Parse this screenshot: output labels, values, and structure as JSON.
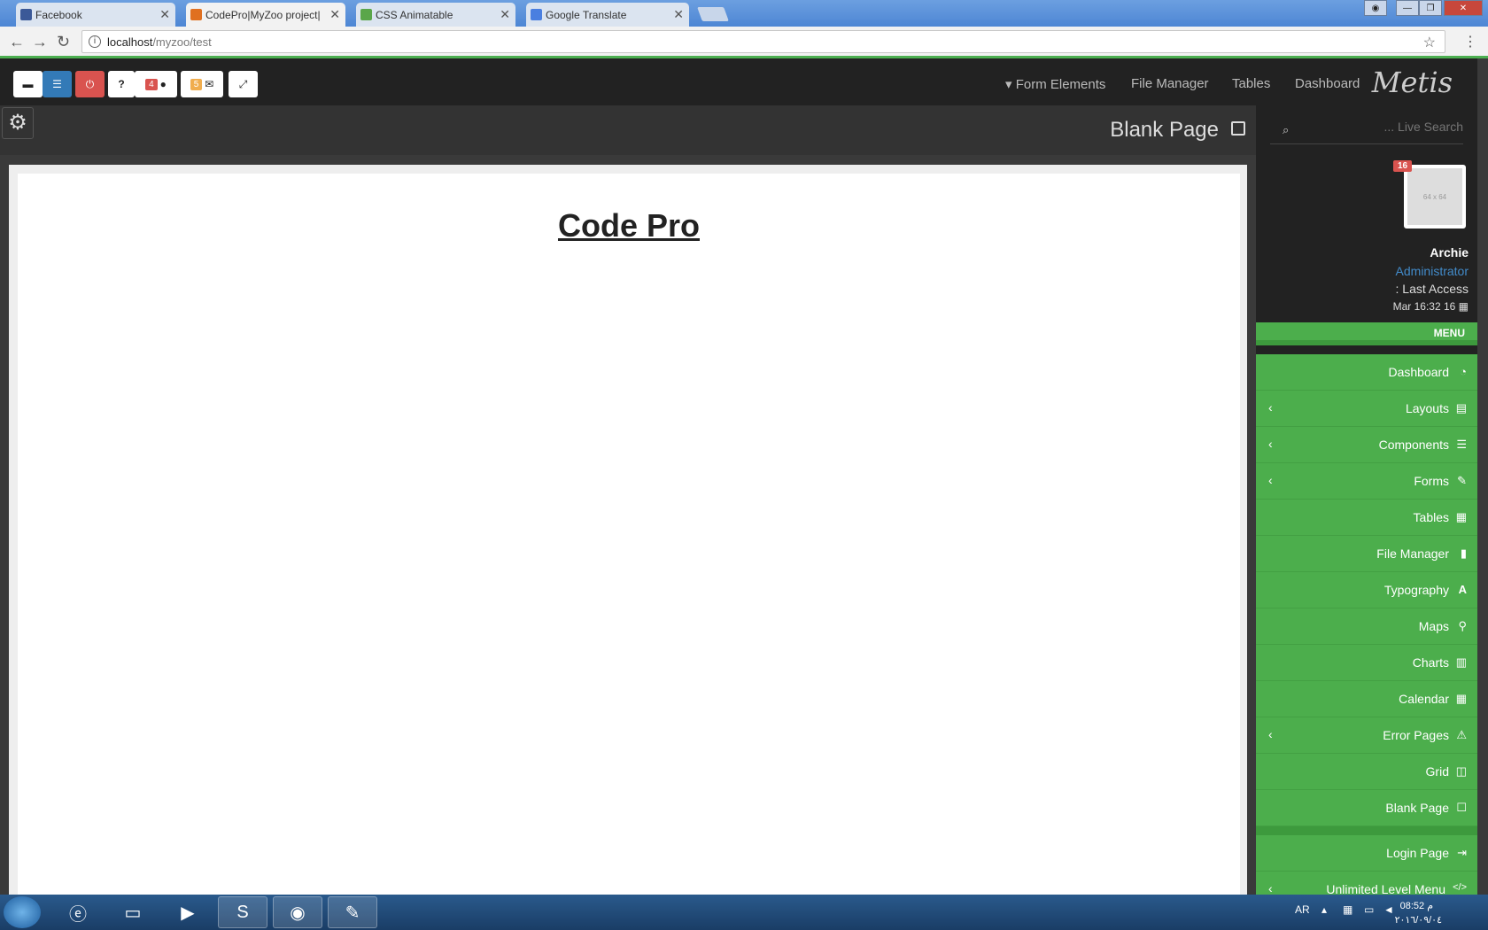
{
  "browser": {
    "tabs": [
      {
        "label": "Facebook",
        "favicon_color": "#3b5998"
      },
      {
        "label": "CodePro|MyZoo project|",
        "favicon_color": "#e07020"
      },
      {
        "label": "CSS Animatable",
        "favicon_color": "#5aa64a"
      },
      {
        "label": "Google Translate",
        "favicon_color": "#4a7fe0"
      }
    ],
    "url_host": "localhost",
    "url_path": "/myzoo/test"
  },
  "topnav": {
    "buttons": [
      {
        "icon": "comment-icon"
      },
      {
        "icon": "bars-icon"
      },
      {
        "icon": "power-icon"
      },
      {
        "label": "?"
      },
      {
        "badge": "4",
        "icon": "comments-icon"
      },
      {
        "badge": "5",
        "icon": "envelope-icon"
      },
      {
        "icon": "expand-icon"
      }
    ],
    "links": [
      "Form Elements",
      "File Manager",
      "Tables",
      "Dashboard"
    ],
    "brand": "Metis"
  },
  "header": {
    "title": "Blank Page"
  },
  "content": {
    "title": "Code Pro"
  },
  "sidebar": {
    "search_placeholder": "... Live Search",
    "avatar_text": "64 x 64",
    "avatar_badge": "16",
    "user_name": "Archie",
    "user_role": "Administrator",
    "last_access_label": ": Last Access",
    "last_access_date": "Mar 16:32 16",
    "menu_header": "MENU",
    "menu": [
      {
        "label": "Dashboard",
        "icon": "dashboard-icon",
        "glyph": "◔",
        "submenu": false
      },
      {
        "label": "Layouts",
        "icon": "layouts-icon",
        "glyph": "▤",
        "submenu": true
      },
      {
        "label": "Components",
        "icon": "components-icon",
        "glyph": "☰",
        "submenu": true
      },
      {
        "label": "Forms",
        "icon": "pencil-icon",
        "glyph": "✎",
        "submenu": true
      },
      {
        "label": "Tables",
        "icon": "table-icon",
        "glyph": "▦",
        "submenu": false
      },
      {
        "label": "File Manager",
        "icon": "file-icon",
        "glyph": "▮",
        "submenu": false
      },
      {
        "label": "Typography",
        "icon": "font-icon",
        "glyph": "A",
        "submenu": false
      },
      {
        "label": "Maps",
        "icon": "map-marker-icon",
        "glyph": "⚲",
        "submenu": false
      },
      {
        "label": "Charts",
        "icon": "bar-chart-icon",
        "glyph": "▥",
        "submenu": false
      },
      {
        "label": "Calendar",
        "icon": "calendar-icon",
        "glyph": "▦",
        "submenu": false
      },
      {
        "label": "Error Pages",
        "icon": "warning-icon",
        "glyph": "⚠",
        "submenu": true
      },
      {
        "label": "Grid",
        "icon": "columns-icon",
        "glyph": "◫",
        "submenu": false
      },
      {
        "label": "Blank Page",
        "icon": "square-icon",
        "glyph": "☐",
        "submenu": false
      }
    ],
    "menu_bottom": [
      {
        "label": "Login Page",
        "icon": "sign-in-icon",
        "glyph": "⇥",
        "submenu": false
      },
      {
        "label": "Unlimited Level Menu",
        "icon": "code-icon",
        "glyph": "</>",
        "submenu": true
      }
    ]
  },
  "taskbar": {
    "lang": "AR",
    "time": "08:52 م",
    "date": "٢٠١٦/٠٩/٠٤"
  }
}
